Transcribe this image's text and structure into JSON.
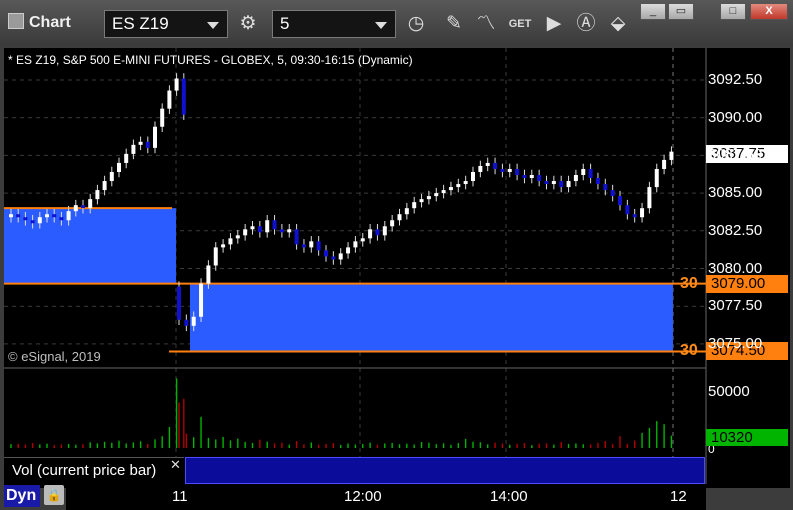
{
  "window": {
    "title": "Chart",
    "symbol": "ES Z19",
    "interval": "5",
    "buttons": [
      "_",
      "▭",
      "□",
      "X"
    ]
  },
  "toolbar": {
    "icons": [
      "gear-icon",
      "clock-icon",
      "pencil-icon",
      "studies-icon",
      "get-icon",
      "play-icon",
      "alert-icon",
      "tools-icon"
    ],
    "get_label": "GET"
  },
  "chart": {
    "header": "* ES Z19, S&P 500 E-MINI FUTURES - GLOBEX, 5, 09:30-16:15 (Dynamic)",
    "copyright": "© eSignal, 2019",
    "current_price": "3087.75",
    "order_top_price": "3079.00",
    "order_bottom_price": "3074.50",
    "order_top_qty": "30",
    "order_bottom_qty": "30",
    "volume_value": "10320",
    "volume_panel_label": "Vol (current price bar)",
    "dyn_label": "Dyn",
    "colors": {
      "up": "#ffffff",
      "down": "#1010d0",
      "zone": "#2a5cff",
      "order": "#ff7f0f",
      "vol_up": "#00b400",
      "vol_down": "#b40000"
    }
  },
  "chart_data": {
    "type": "line",
    "y_ticks": [
      "3092.50",
      "3090.00",
      "3087.50",
      "3085.00",
      "3082.50",
      "3080.00",
      "3077.50",
      "3075.00"
    ],
    "volume_ticks": [
      "50000",
      "0"
    ],
    "x_ticks": [
      "11",
      "12:00",
      "14:00",
      "12"
    ],
    "price_range": [
      3074.0,
      3093.5
    ],
    "closes": [
      3083.6,
      3083.4,
      3083.2,
      3083.0,
      3083.4,
      3083.6,
      3083.4,
      3083.2,
      3083.8,
      3084.2,
      3084.0,
      3084.6,
      3085.2,
      3085.8,
      3086.4,
      3087.0,
      3087.6,
      3088.2,
      3088.4,
      3088.0,
      3089.4,
      3090.6,
      3091.8,
      3092.6,
      3090.2,
      3076.6,
      3076.2,
      3076.8,
      3079.0,
      3080.2,
      3081.4,
      3081.6,
      3082.0,
      3082.2,
      3082.6,
      3082.8,
      3082.4,
      3083.2,
      3082.6,
      3082.4,
      3082.6,
      3081.6,
      3081.4,
      3081.8,
      3081.2,
      3080.8,
      3080.6,
      3081.0,
      3081.4,
      3081.8,
      3082.0,
      3082.6,
      3082.2,
      3082.8,
      3083.2,
      3083.6,
      3084.0,
      3084.4,
      3084.6,
      3084.8,
      3085.0,
      3085.2,
      3085.4,
      3085.6,
      3085.8,
      3086.4,
      3086.8,
      3087.0,
      3086.6,
      3086.4,
      3086.6,
      3086.2,
      3086.0,
      3086.2,
      3085.8,
      3085.6,
      3085.8,
      3085.4,
      3085.8,
      3086.2,
      3086.6,
      3086.0,
      3085.6,
      3085.2,
      3084.8,
      3084.2,
      3083.6,
      3083.4,
      3084.0,
      3085.4,
      3086.6,
      3087.2,
      3087.75
    ],
    "volumes": [
      3200,
      3500,
      2800,
      4100,
      3000,
      3600,
      2500,
      2900,
      3300,
      2700,
      3100,
      4800,
      3900,
      5200,
      4400,
      6100,
      3800,
      4700,
      5600,
      3300,
      7200,
      9800,
      17500,
      58000,
      41000,
      38000,
      12000,
      9000,
      26000,
      8400,
      7100,
      9200,
      6300,
      7800,
      5100,
      4200,
      6900,
      5300,
      3900,
      4400,
      2800,
      5800,
      3100,
      4600,
      2600,
      3400,
      4100,
      2500,
      3700,
      2900,
      3300,
      4500,
      2700,
      3800,
      4200,
      3100,
      3600,
      2900,
      5000,
      4400,
      3200,
      3900,
      2600,
      4100,
      7600,
      5200,
      4800,
      3000,
      4400,
      3700,
      2700,
      3500,
      4200,
      2400,
      3600,
      3900,
      2800,
      4900,
      3300,
      3800,
      3100,
      2900,
      4300,
      5800,
      3200,
      9800,
      3400,
      6100,
      12600,
      16800,
      22400,
      19800,
      10320
    ],
    "buy_zones": [
      {
        "from_bar": 0,
        "to_bar": 24,
        "top": 3084.0,
        "bottom": 3079.0
      },
      {
        "from_bar": 25,
        "to_bar": 92,
        "top": 3079.0,
        "bottom": 3074.5
      }
    ],
    "order_lines": [
      3084.0,
      3079.0,
      3074.5
    ]
  }
}
